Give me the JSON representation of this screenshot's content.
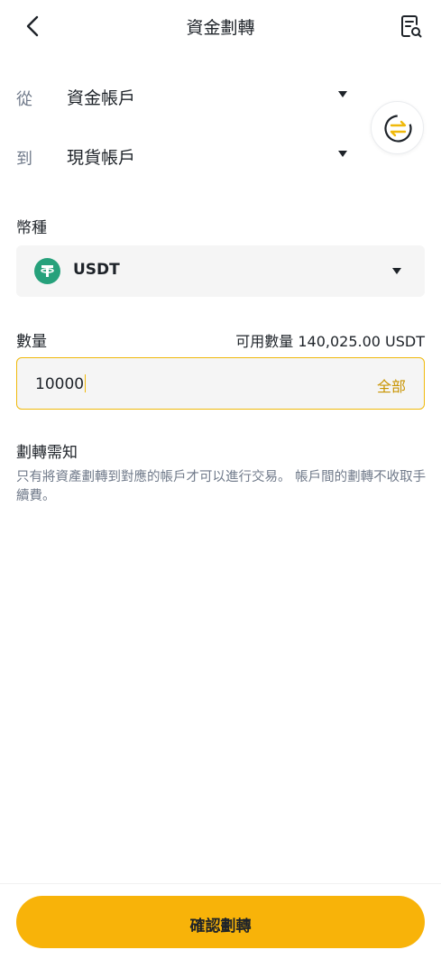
{
  "header": {
    "title": "資金劃轉",
    "back_icon": "chevron-left-icon",
    "record_icon": "document-search-icon"
  },
  "transfer": {
    "from_prefix": "從",
    "from_account": "資金帳戶",
    "to_prefix": "到",
    "to_account": "現貨帳戶",
    "swap_icon": "swap-arrows-icon"
  },
  "coin": {
    "label": "幣種",
    "selected": "USDT",
    "logo_icon": "tether-logo-icon",
    "logo_color": "#26a17b"
  },
  "amount": {
    "label": "數量",
    "available_text": "可用數量 140,025.00 USDT",
    "value": "10000",
    "max_label": "全部"
  },
  "notice": {
    "title": "劃轉需知",
    "text": "只有將資產劃轉到對應的帳戶才可以進行交易。 帳戶間的劃轉不收取手續費。"
  },
  "footer": {
    "confirm_label": "確認劃轉"
  },
  "colors": {
    "accent": "#f0b90b",
    "button": "#f8b309",
    "max_text": "#c99400",
    "muted_text": "#707a8a"
  }
}
